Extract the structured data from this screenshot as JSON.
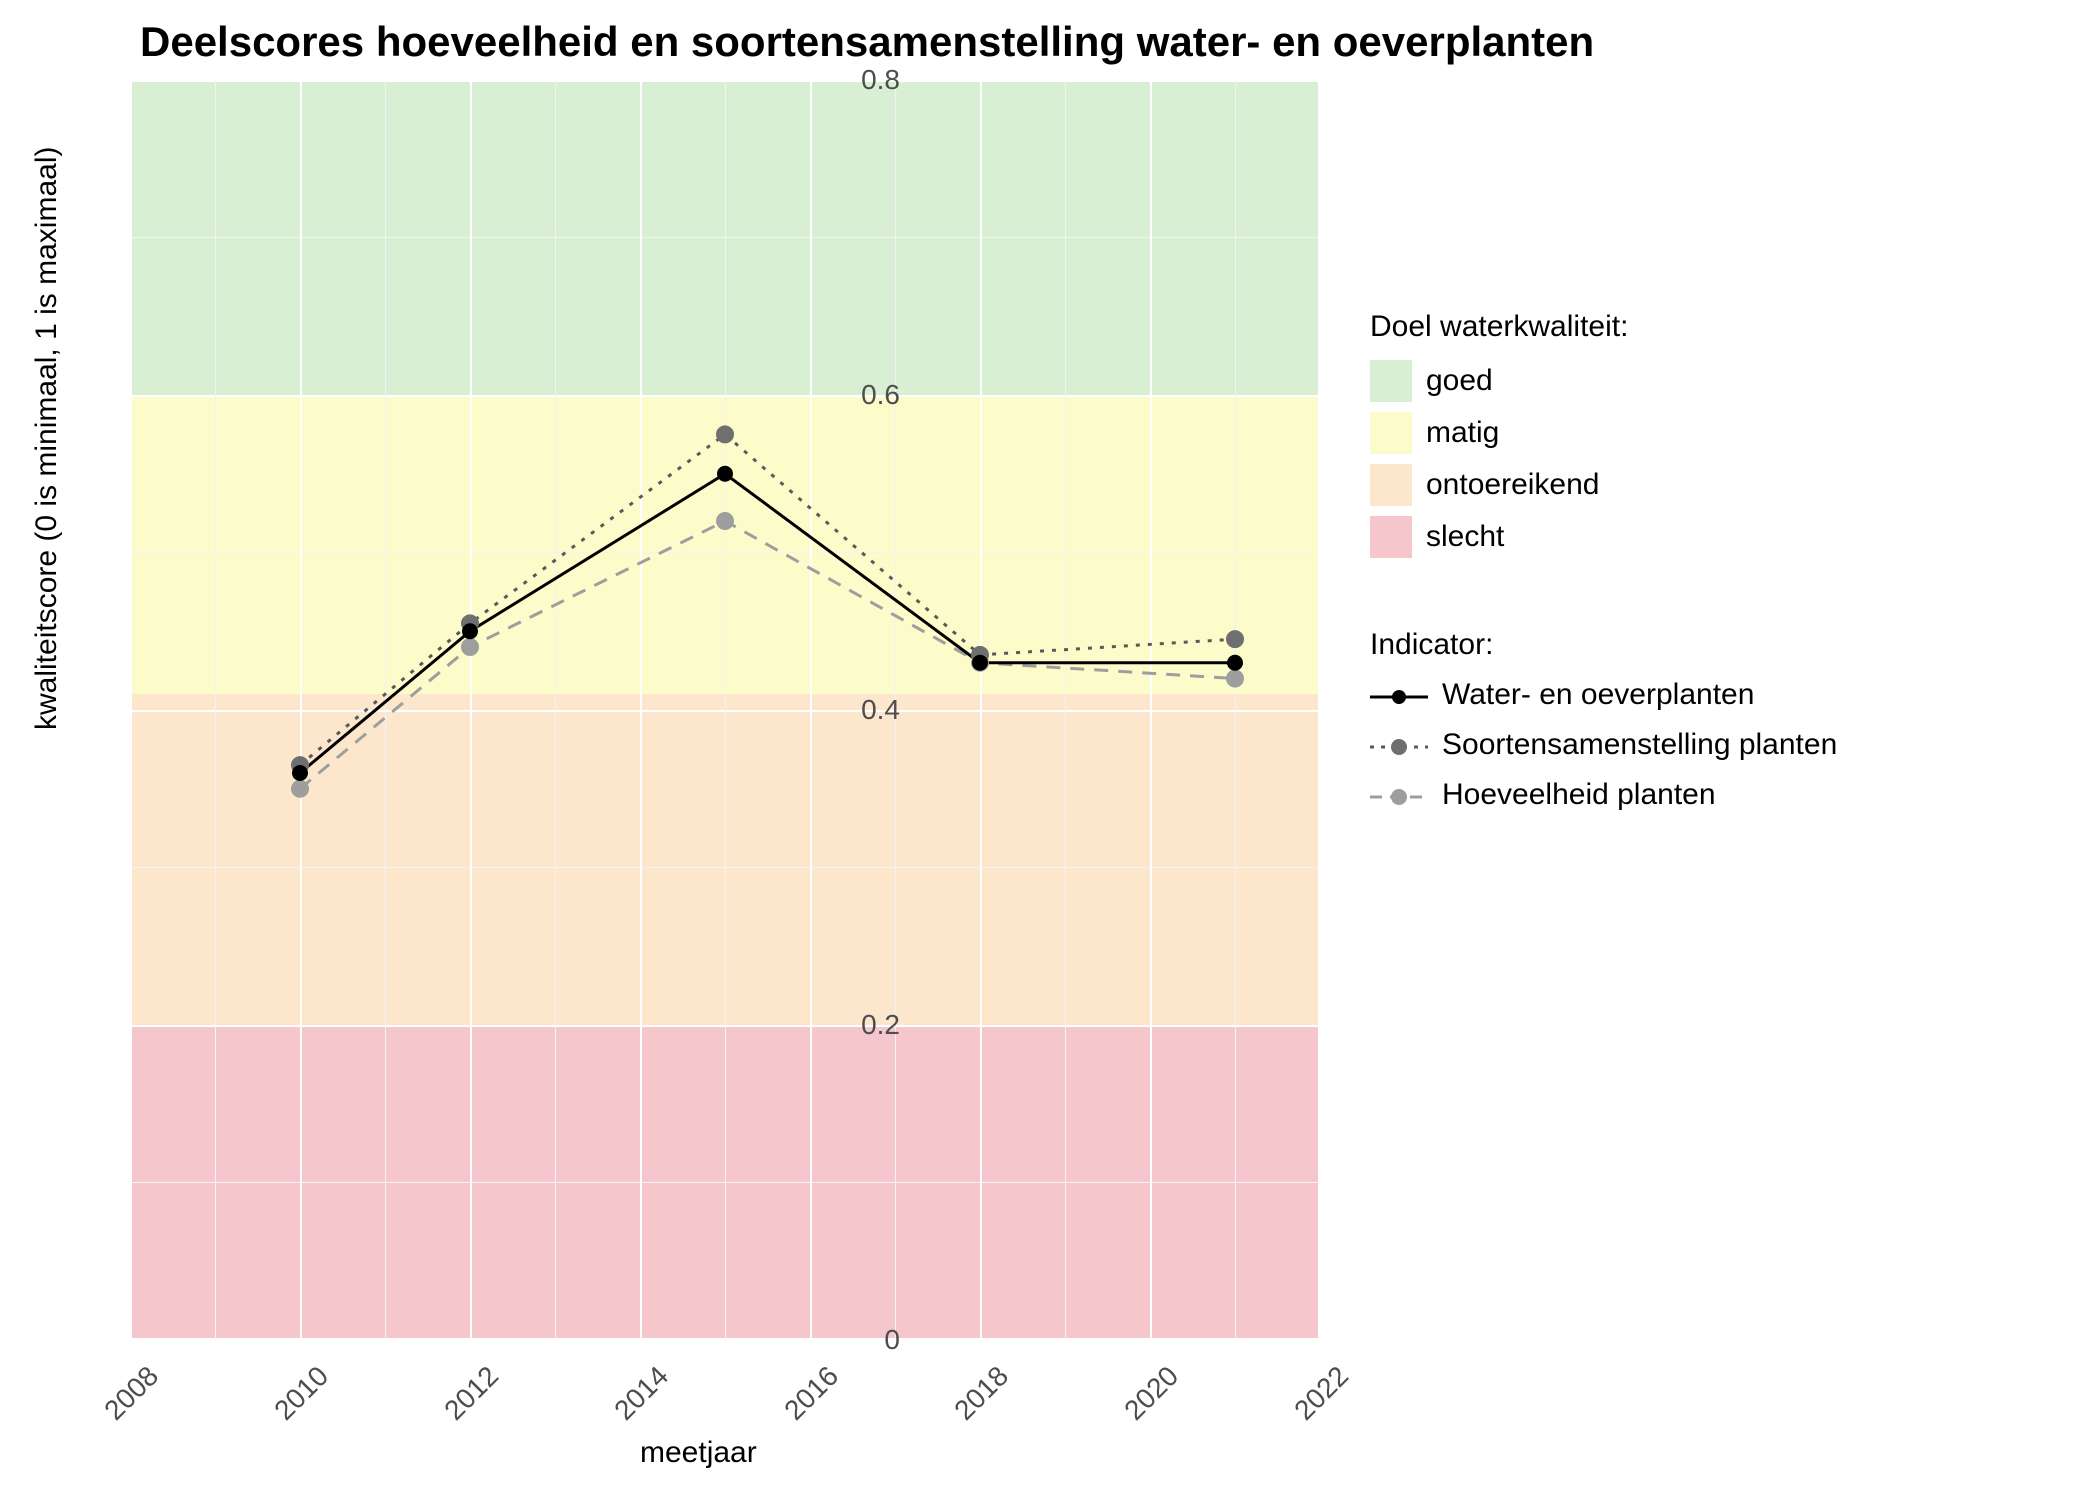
{
  "chart_data": {
    "type": "line",
    "title": "Deelscores hoeveelheid en soortensamenstelling water- en oeverplanten",
    "xlabel": "meetjaar",
    "ylabel": "kwaliteitscore (0 is minimaal, 1 is maximaal)",
    "x_ticks": [
      2008,
      2010,
      2012,
      2014,
      2016,
      2018,
      2020,
      2022
    ],
    "y_ticks": [
      0.0,
      0.2,
      0.4,
      0.6,
      0.8
    ],
    "xlim": [
      2008,
      2022
    ],
    "ylim": [
      0.0,
      0.8
    ],
    "bands": {
      "title": "Doel waterkwaliteit:",
      "levels": [
        {
          "name": "goed",
          "range": [
            0.6,
            0.8
          ],
          "color": "#d8efd3"
        },
        {
          "name": "matig",
          "range": [
            0.41,
            0.6
          ],
          "color": "#fcfccb"
        },
        {
          "name": "ontoereikend",
          "range": [
            0.2,
            0.41
          ],
          "color": "#fde7cc"
        },
        {
          "name": "slecht",
          "range": [
            0.0,
            0.2
          ],
          "color": "#f6c6cd"
        }
      ]
    },
    "series_x": [
      2010,
      2012,
      2015,
      2018,
      2021
    ],
    "series": [
      {
        "name": "Water- en oeverplanten",
        "values": [
          0.36,
          0.45,
          0.55,
          0.43,
          0.43
        ],
        "color": "#000000",
        "dash": "solid",
        "marker": "#000000"
      },
      {
        "name": "Soortensamenstelling planten",
        "values": [
          0.365,
          0.455,
          0.575,
          0.435,
          0.445
        ],
        "color": "#595959",
        "dash": "dotted",
        "marker": "#6f6f6f"
      },
      {
        "name": "Hoeveelheid planten",
        "values": [
          0.35,
          0.44,
          0.52,
          0.43,
          0.42
        ],
        "color": "#9e9e9e",
        "dash": "dashed",
        "marker": "#9e9e9e"
      }
    ],
    "legend2_title": "Indicator:"
  }
}
